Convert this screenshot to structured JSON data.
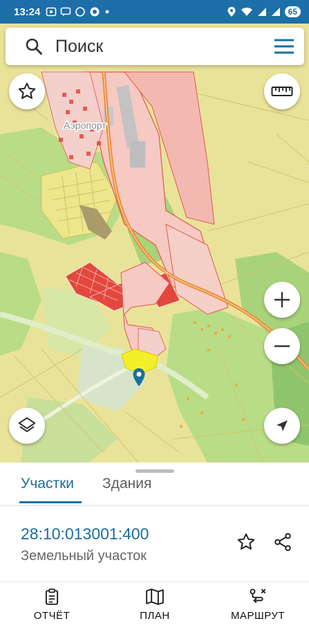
{
  "status_bar": {
    "time": "13:24",
    "battery": "65",
    "left_icons": [
      "gallery-icon",
      "messages-icon",
      "whatsapp-icon",
      "chat-icon",
      "dot-icon"
    ],
    "right_icons": [
      "location-icon",
      "wifi-icon",
      "signal-icon",
      "signal-icon",
      "battery-icon"
    ]
  },
  "search": {
    "placeholder": "Поиск"
  },
  "map": {
    "place_label": "Аэропорт",
    "colors": {
      "base": "#e9e39a",
      "green": "#b9dc86",
      "parcel_pink": "#f6c9c3",
      "parcel_outline": "#e0574c",
      "red_parcel": "#e2483e",
      "highway": "#e8862a",
      "selected": "#f4ef2b",
      "accent": "#1a6f9e"
    }
  },
  "sheet": {
    "tabs": [
      {
        "label": "Участки",
        "active": true
      },
      {
        "label": "Здания",
        "active": false
      }
    ],
    "parcel": {
      "cadastral_number": "28:10:013001:400",
      "type": "Земельный участок"
    }
  },
  "bottom_nav": {
    "items": [
      {
        "label": "ОТЧЁТ",
        "icon": "clipboard-icon"
      },
      {
        "label": "ПЛАН",
        "icon": "map-icon"
      },
      {
        "label": "МАРШРУТ",
        "icon": "route-icon"
      }
    ]
  }
}
